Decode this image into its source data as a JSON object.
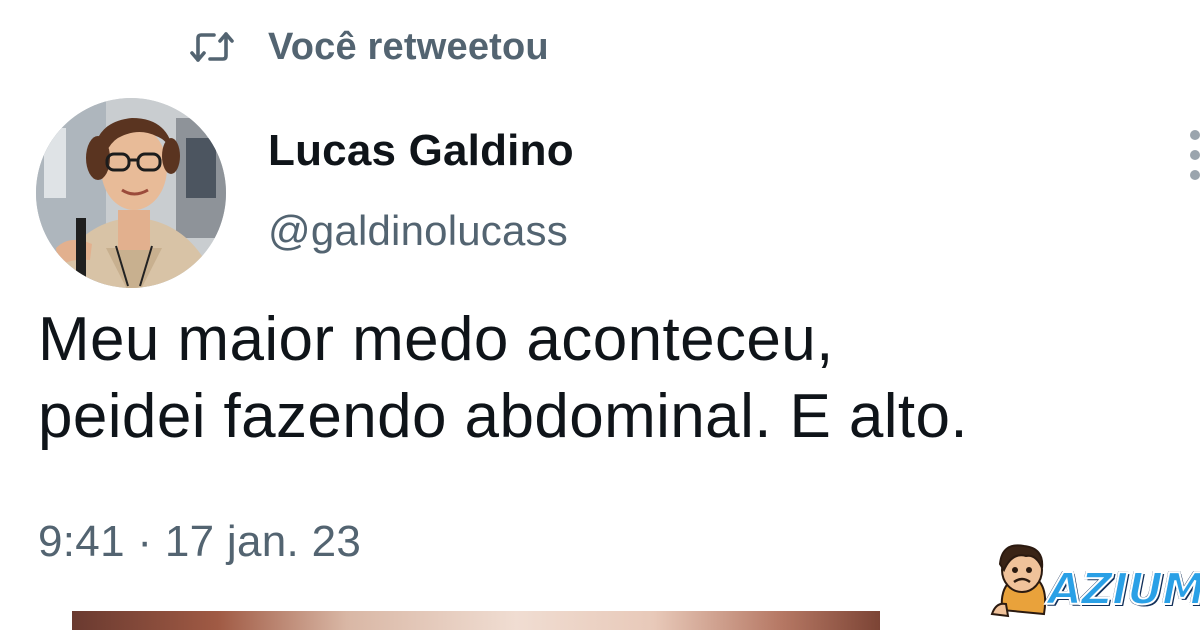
{
  "retweet": {
    "label": "Você retweetou",
    "icon": "retweet-icon"
  },
  "author": {
    "display_name": "Lucas Galdino",
    "handle": "@galdinolucass",
    "avatar": "avatar-photo"
  },
  "tweet": {
    "text": "Meu maior medo aconteceu,\npeidei fazendo abdominal. E alto.",
    "timestamp": "9:41 · 17 jan. 23"
  },
  "menu": {
    "icon": "more-vertical-icon"
  },
  "watermark": {
    "text": "AZIUM"
  },
  "colors": {
    "text_primary": "#0f1419",
    "text_secondary": "#536471",
    "background": "#ffffff",
    "watermark_blue": "#2aa0e6"
  }
}
